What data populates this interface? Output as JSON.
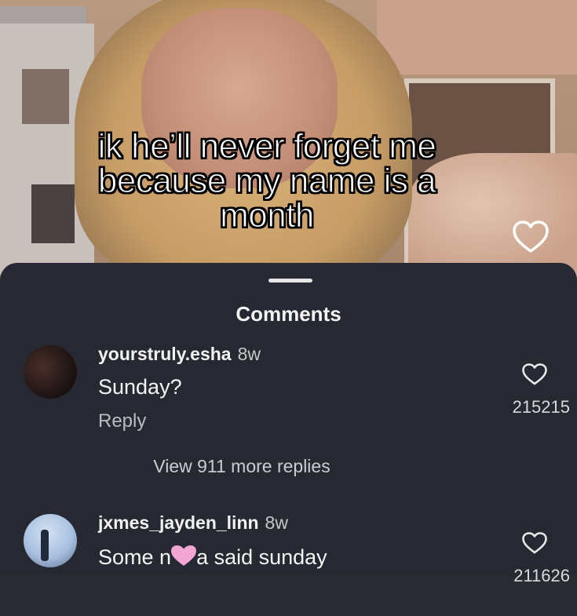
{
  "video": {
    "caption_lines": [
      "ik he’ll never forget me",
      "because my name is a",
      "month"
    ]
  },
  "comments_sheet": {
    "title": "Comments",
    "comments": [
      {
        "username": "yourstruly.esha",
        "age": "8w",
        "text": "Sunday?",
        "reply_label": "Reply",
        "likes": "215215"
      },
      {
        "username": "jxmes_jayden_linn",
        "age": "8w",
        "text_before": "Some n",
        "text_after": "a said sunday",
        "censor_emoji": "pink-heart-emoji",
        "likes": "211626"
      }
    ],
    "view_more_label": "View 911 more replies"
  },
  "colors": {
    "sheet_background": "#262931",
    "caption_fill": "#ffffff",
    "caption_outline": "#000000",
    "censor_heart": "#f3a6d3"
  },
  "icons": {
    "video_like": "heart-outline-icon",
    "comment_like": "heart-outline-icon",
    "censor": "pink-heart-emoji"
  }
}
